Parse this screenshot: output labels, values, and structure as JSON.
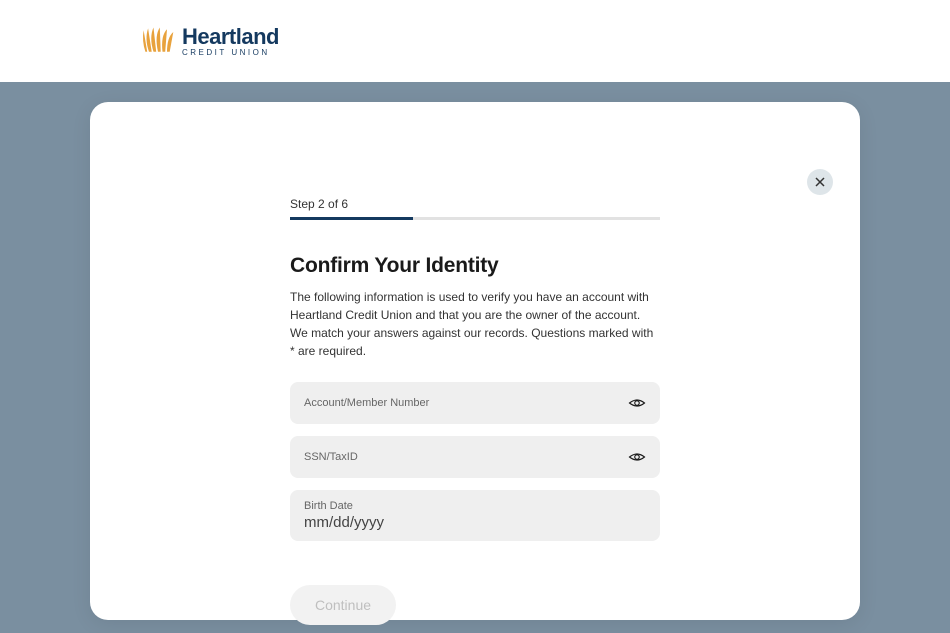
{
  "brand": {
    "name": "Heartland",
    "sub": "CREDIT UNION"
  },
  "step": {
    "label": "Step 2 of 6",
    "current": 2,
    "total": 6
  },
  "page": {
    "title": "Confirm Your Identity",
    "description": "The following information is used to verify you have an account with Heartland Credit Union and that you are the owner of the account. We match your answers against our records. Questions marked with * are required."
  },
  "fields": {
    "account": {
      "label": "Account/Member Number",
      "value": ""
    },
    "ssn": {
      "label": "SSN/TaxID",
      "value": ""
    },
    "birthdate": {
      "label": "Birth Date",
      "placeholder": "mm/dd/yyyy"
    }
  },
  "buttons": {
    "continue": "Continue"
  }
}
